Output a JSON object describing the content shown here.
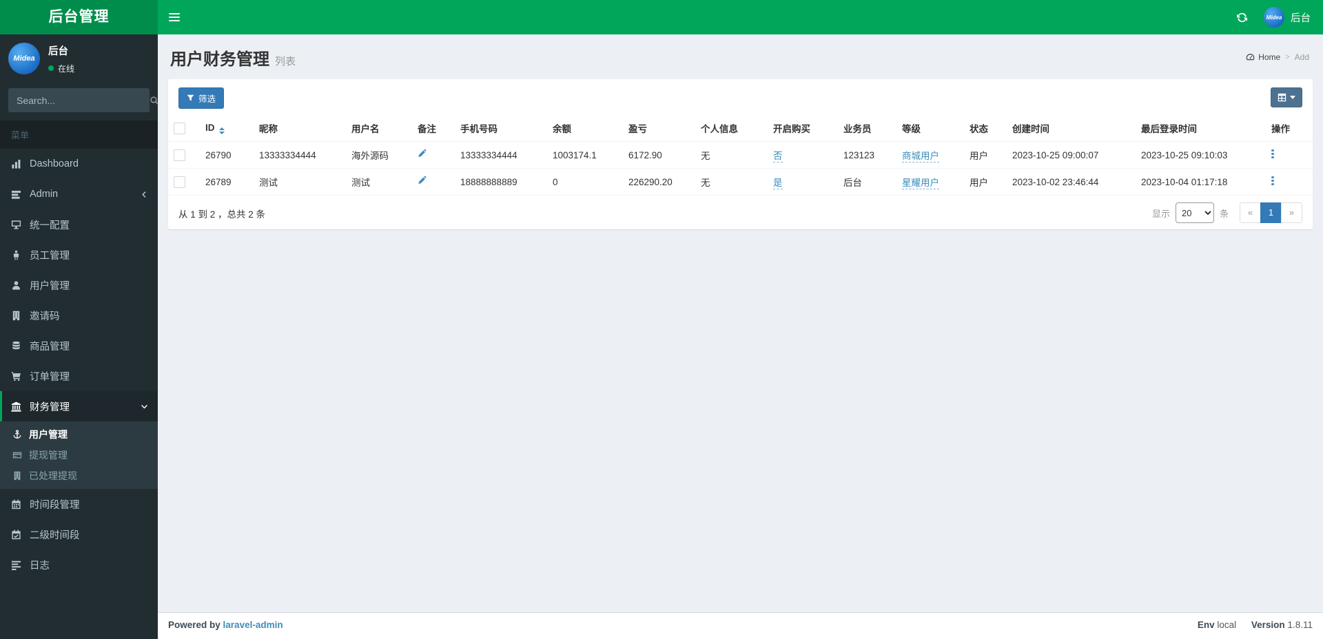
{
  "colors": {
    "header_green": "#00a65a",
    "logo_green": "#008d4c",
    "sidebar_dark": "#222d32",
    "submenu_dark": "#2c3b41",
    "accent_blue": "#3c8dbc",
    "filter_button_blue": "#337ab7",
    "column_button_slate": "#4d7291",
    "active_page_blue": "#337ab7",
    "status_online_green": "#00a65a"
  },
  "header": {
    "logo_text": "后台管理",
    "user_name": "后台",
    "avatar_text": "Midea"
  },
  "sidebar": {
    "user_name": "后台",
    "user_status": "在线",
    "avatar_text": "Midea",
    "search_placeholder": "Search...",
    "menu_label": "菜单",
    "items": [
      {
        "label": "Dashboard",
        "icon": "bar-chart-icon"
      },
      {
        "label": "Admin",
        "icon": "tasks-icon",
        "chevron": "left"
      },
      {
        "label": "统一配置",
        "icon": "desktop-icon"
      },
      {
        "label": "员工管理",
        "icon": "male-icon"
      },
      {
        "label": "用户管理",
        "icon": "user-icon"
      },
      {
        "label": "邀请码",
        "icon": "building-icon"
      },
      {
        "label": "商品管理",
        "icon": "database-icon"
      },
      {
        "label": "订单管理",
        "icon": "cart-icon"
      },
      {
        "label": "财务管理",
        "icon": "bank-icon",
        "chevron": "down",
        "active": true,
        "children": [
          {
            "label": "用户管理",
            "icon": "anchor-icon",
            "active": true
          },
          {
            "label": "提现管理",
            "icon": "credit-card-icon"
          },
          {
            "label": "已处理提现",
            "icon": "building-icon"
          }
        ]
      },
      {
        "label": "时间段管理",
        "icon": "calendar-icon"
      },
      {
        "label": "二级时间段",
        "icon": "calendar-check-icon"
      },
      {
        "label": "日志",
        "icon": "log-icon"
      }
    ]
  },
  "page": {
    "title": "用户财务管理",
    "subtitle": "列表",
    "breadcrumb_home": "Home",
    "breadcrumb_separator": ">",
    "breadcrumb_current": "Add"
  },
  "toolbar": {
    "filter_label": "筛选"
  },
  "table": {
    "columns": [
      "",
      "ID",
      "昵称",
      "用户名",
      "备注",
      "手机号码",
      "余额",
      "盈亏",
      "个人信息",
      "开启购买",
      "业务员",
      "等级",
      "状态",
      "创建时间",
      "最后登录时间",
      "操作"
    ],
    "rows": [
      {
        "id": "26790",
        "nickname": "13333334444",
        "username": "海外源码",
        "phone": "13333334444",
        "balance": "1003174.1",
        "profit": "6172.90",
        "personal_info": "无",
        "buy_enabled": "否",
        "salesman": "123123",
        "level": "商城用户",
        "status": "用户",
        "created_at": "2023-10-25 09:00:07",
        "last_login": "2023-10-25 09:10:03"
      },
      {
        "id": "26789",
        "nickname": "测试",
        "username": "测试",
        "phone": "18888888889",
        "balance": "0",
        "profit": "226290.20",
        "personal_info": "无",
        "buy_enabled": "是",
        "salesman": "后台",
        "level": "星耀用户",
        "status": "用户",
        "created_at": "2023-10-02 23:46:44",
        "last_login": "2023-10-04 01:17:18"
      }
    ]
  },
  "pagination": {
    "summary": "从 1 到 2 ，总共 2 条",
    "show_label": "显示",
    "per_page": "20",
    "unit_label": "条",
    "prev_symbol": "«",
    "current_page": "1",
    "next_symbol": "»"
  },
  "footer": {
    "powered_by": "Powered by",
    "brand": "laravel-admin",
    "env_label": "Env",
    "env_value": "local",
    "version_label": "Version",
    "version_value": "1.8.11"
  }
}
